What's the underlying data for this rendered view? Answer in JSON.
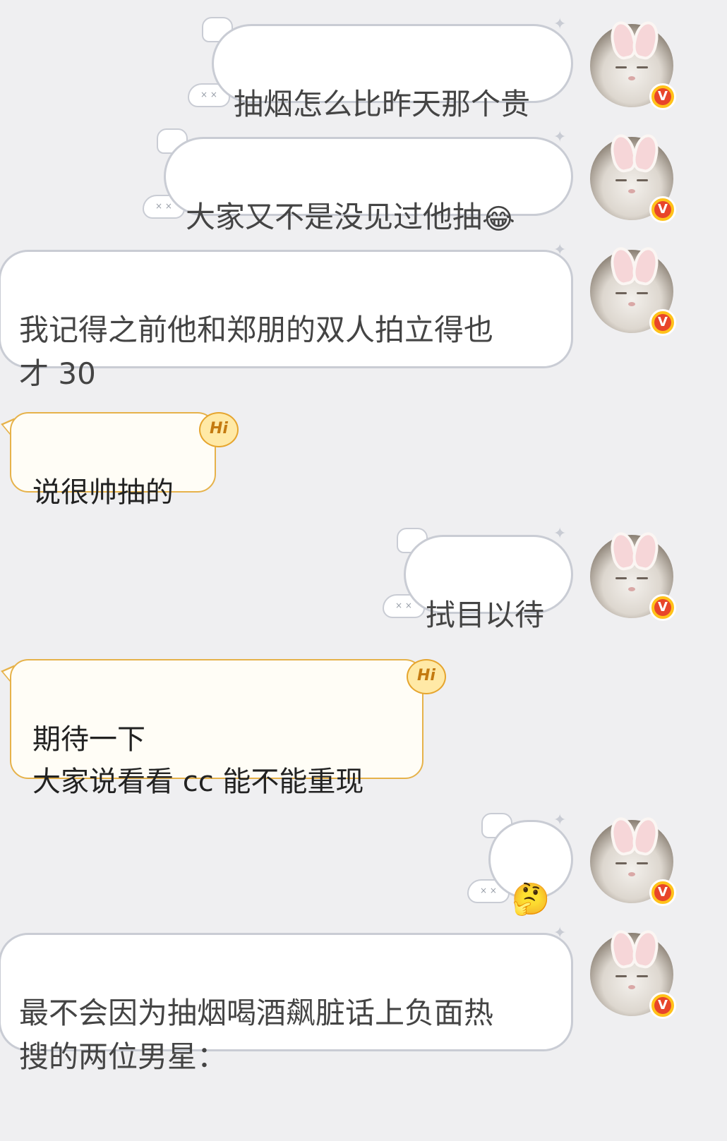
{
  "messages": [
    {
      "side": "right",
      "text": "抽烟怎么比昨天那个贵"
    },
    {
      "side": "right",
      "text": "大家又不是没见过他抽",
      "emoji": "😂"
    },
    {
      "side": "right",
      "text": "我记得之前他和郑朋的双人拍立得也\n才 30"
    },
    {
      "side": "left",
      "text": "说很帅抽的",
      "badge": "Hi"
    },
    {
      "side": "right",
      "text": "拭目以待"
    },
    {
      "side": "left",
      "text": "期待一下\n大家说看看 cc 能不能重现",
      "badge": "Hi"
    },
    {
      "side": "right",
      "text": "",
      "emoji": "🤔"
    },
    {
      "side": "right",
      "text": "最不会因为抽烟喝酒飙脏话上负面热\n搜的两位男星："
    }
  ],
  "avatar": {
    "verified_mark": "V"
  },
  "colors": {
    "background": "#efeff1",
    "self_border": "#c9ccd4",
    "other_border": "#e6b24a",
    "verified": "#ffc21a"
  }
}
